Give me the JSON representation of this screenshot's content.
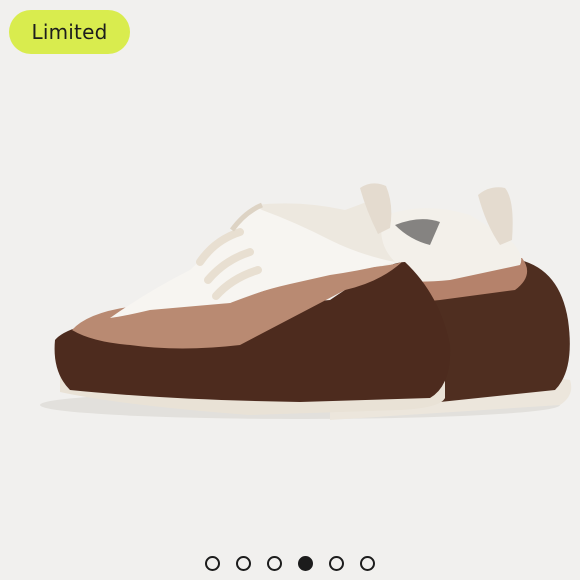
{
  "badge": {
    "label": "Limited"
  },
  "gallery": {
    "photo_subject": "sneaker-pair-photo",
    "slide_count": 6,
    "active_index": 3
  },
  "colors": {
    "badge_bg": "#d9ec4e",
    "dot": "#1c1c1c",
    "background": "#f1f0ee"
  }
}
